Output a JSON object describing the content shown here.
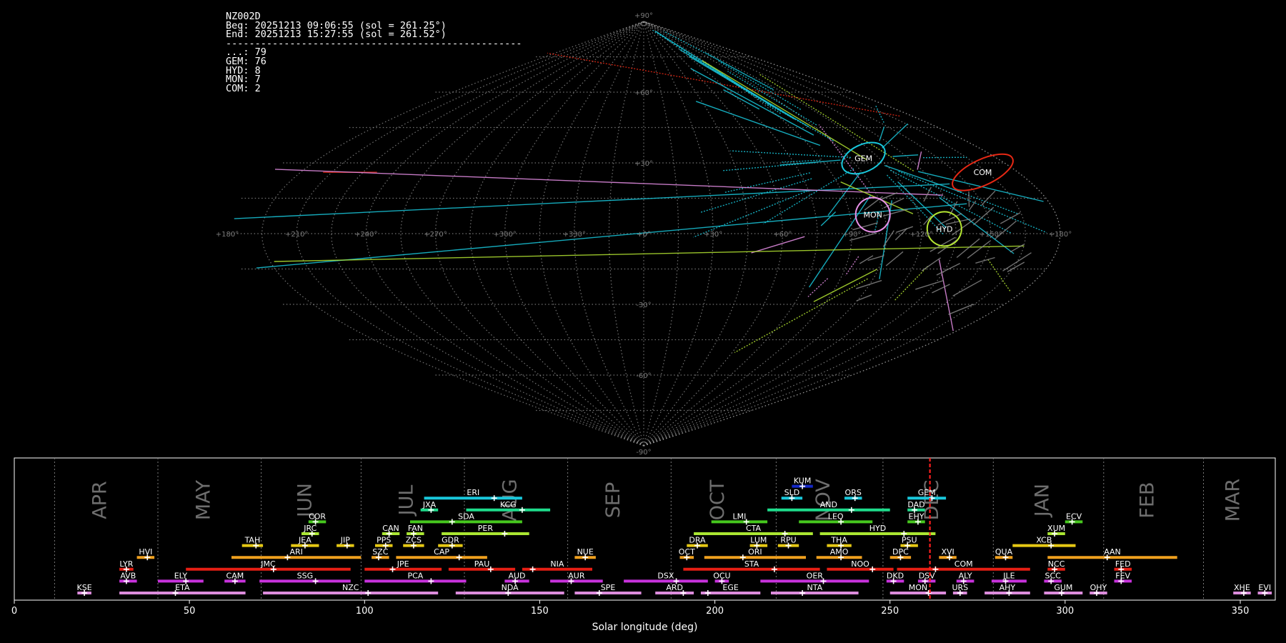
{
  "header": {
    "station": "NZ002D",
    "begin": "Beg: 20251213 09:06:55 (sol = 261.25°)",
    "end": "End: 20251213 15:27:55 (sol = 261.52°)",
    "separator": "---------------------------------------------------",
    "counts": [
      {
        "code": "...",
        "count": 79
      },
      {
        "code": "GEM",
        "count": 76
      },
      {
        "code": "HYD",
        "count": 8
      },
      {
        "code": "MON",
        "count": 7
      },
      {
        "code": "COM",
        "count": 2
      }
    ]
  },
  "colors": {
    "background": "#000000",
    "grid": "#9a9a9a",
    "GEM": "#19c8dc",
    "HYD": "#b4e632",
    "MON": "#e890e8",
    "COM": "#e62814",
    "sporadic": "#8c8c8c",
    "current_sol": "#ff1e1e"
  },
  "chart_data": [
    {
      "type": "sky-map",
      "projection": "sinusoidal",
      "lat_ticks": [
        "+90°",
        "+60°",
        "+30°",
        "+0°",
        "-30°",
        "-60°",
        "-90°"
      ],
      "lon_ticks": [
        "+180°",
        "+150°",
        "+120°",
        "+90°",
        "+60°",
        "+30°",
        "+0°",
        "+330°",
        "+300°",
        "+270°",
        "+240°",
        "+210°",
        "+180°"
      ],
      "radiants": [
        {
          "code": "COM",
          "ra": 163,
          "dec": 26,
          "color": "#e62814",
          "count": 2
        },
        {
          "code": "GEM",
          "ra": 112,
          "dec": 32,
          "color": "#19c8dc",
          "count": 76
        },
        {
          "code": "MON",
          "ra": 100,
          "dec": 8,
          "color": "#e890e8",
          "count": 7
        },
        {
          "code": "HYD",
          "ra": 130,
          "dec": 2,
          "color": "#b4e632",
          "count": 8
        }
      ]
    },
    {
      "type": "timeline",
      "xlabel": "Solar longitude (deg)",
      "xlim": [
        0,
        360
      ],
      "xticks": [
        0,
        50,
        100,
        150,
        200,
        250,
        300,
        350
      ],
      "current_sol": 261.4,
      "months": [
        {
          "label": "APR",
          "start": 11.5,
          "end": 41
        },
        {
          "label": "MAY",
          "start": 41,
          "end": 70.5
        },
        {
          "label": "JUN",
          "start": 70.5,
          "end": 99
        },
        {
          "label": "JUL",
          "start": 99,
          "end": 128.5
        },
        {
          "label": "AUG",
          "start": 128.5,
          "end": 158
        },
        {
          "label": "SEP",
          "start": 158,
          "end": 187.5
        },
        {
          "label": "OCT",
          "start": 187.5,
          "end": 217.5
        },
        {
          "label": "NOV",
          "start": 217.5,
          "end": 248
        },
        {
          "label": "DEC",
          "start": 248,
          "end": 279.5
        },
        {
          "label": "JAN",
          "start": 279.5,
          "end": 311
        },
        {
          "label": "FEB",
          "start": 311,
          "end": 339.5
        },
        {
          "label": "MAR",
          "start": 339.5,
          "end": 371.5
        }
      ],
      "showers": [
        {
          "code": "KUM",
          "row": 9,
          "start": 222,
          "end": 228,
          "peak": 225,
          "color": "#1428c8"
        },
        {
          "code": "ERI",
          "row": 8,
          "start": 117,
          "end": 145,
          "peak": 137,
          "color": "#19c8dc"
        },
        {
          "code": "SLD",
          "row": 8,
          "start": 219,
          "end": 225,
          "peak": 222,
          "color": "#19c8dc"
        },
        {
          "code": "ORS",
          "row": 8,
          "start": 237,
          "end": 242,
          "peak": 240,
          "color": "#19c8dc"
        },
        {
          "code": "GEM",
          "row": 8,
          "start": 255,
          "end": 266,
          "peak": 262,
          "color": "#19c8dc"
        },
        {
          "code": "JXA",
          "row": 7,
          "start": 116,
          "end": 121,
          "peak": 119,
          "color": "#1edc8c"
        },
        {
          "code": "KCG",
          "row": 7,
          "start": 129,
          "end": 153,
          "peak": 145,
          "color": "#1edc8c"
        },
        {
          "code": "AND",
          "row": 7,
          "start": 215,
          "end": 250,
          "peak": 239,
          "color": "#1edc8c"
        },
        {
          "code": "DAD",
          "row": 7,
          "start": 255,
          "end": 260,
          "peak": 257,
          "color": "#1edc8c"
        },
        {
          "code": "COR",
          "row": 6,
          "start": 84,
          "end": 89,
          "peak": 86,
          "color": "#46c81e"
        },
        {
          "code": "SDA",
          "row": 6,
          "start": 113,
          "end": 145,
          "peak": 125,
          "color": "#46c81e"
        },
        {
          "code": "LMI",
          "row": 6,
          "start": 199,
          "end": 215,
          "peak": 209,
          "color": "#46c81e"
        },
        {
          "code": "LEO",
          "row": 6,
          "start": 224,
          "end": 245,
          "peak": 236,
          "color": "#46c81e"
        },
        {
          "code": "EHY",
          "row": 6,
          "start": 255,
          "end": 260,
          "peak": 258,
          "color": "#46c81e"
        },
        {
          "code": "ECV",
          "row": 6,
          "start": 300,
          "end": 305,
          "peak": 302,
          "color": "#46c81e"
        },
        {
          "code": "JRC",
          "row": 5,
          "start": 82,
          "end": 87,
          "peak": 85,
          "color": "#aae632"
        },
        {
          "code": "CAN",
          "row": 5,
          "start": 105,
          "end": 110,
          "peak": 107,
          "color": "#aae632"
        },
        {
          "code": "FAN",
          "row": 5,
          "start": 112,
          "end": 117,
          "peak": 114,
          "color": "#aae632"
        },
        {
          "code": "PER",
          "row": 5,
          "start": 122,
          "end": 147,
          "peak": 140,
          "color": "#aae632"
        },
        {
          "code": "CTA",
          "row": 5,
          "start": 194,
          "end": 228,
          "peak": 220,
          "color": "#aae632"
        },
        {
          "code": "HYD",
          "row": 5,
          "start": 230,
          "end": 263,
          "peak": 254,
          "color": "#aae632"
        },
        {
          "code": "XUM",
          "row": 5,
          "start": 295,
          "end": 300,
          "peak": 297,
          "color": "#aae632"
        },
        {
          "code": "TAH",
          "row": 4,
          "start": 65,
          "end": 71,
          "peak": 69,
          "color": "#e6c814"
        },
        {
          "code": "JEA",
          "row": 4,
          "start": 79,
          "end": 87,
          "peak": 83,
          "color": "#e6c814"
        },
        {
          "code": "JIP",
          "row": 4,
          "start": 92,
          "end": 97,
          "peak": 95,
          "color": "#e6c814"
        },
        {
          "code": "PPS",
          "row": 4,
          "start": 103,
          "end": 108,
          "peak": 106,
          "color": "#e6c814"
        },
        {
          "code": "ZCS",
          "row": 4,
          "start": 111,
          "end": 117,
          "peak": 114,
          "color": "#e6c814"
        },
        {
          "code": "GDR",
          "row": 4,
          "start": 121,
          "end": 128,
          "peak": 125,
          "color": "#e6c814"
        },
        {
          "code": "DRA",
          "row": 4,
          "start": 192,
          "end": 198,
          "peak": 195,
          "color": "#e6c814"
        },
        {
          "code": "LUM",
          "row": 4,
          "start": 210,
          "end": 215,
          "peak": 212,
          "color": "#e6c814"
        },
        {
          "code": "RPU",
          "row": 4,
          "start": 218,
          "end": 224,
          "peak": 221,
          "color": "#e6c814"
        },
        {
          "code": "THA",
          "row": 4,
          "start": 232,
          "end": 239,
          "peak": 236,
          "color": "#e6c814"
        },
        {
          "code": "PSU",
          "row": 4,
          "start": 253,
          "end": 258,
          "peak": 255,
          "color": "#e6c814"
        },
        {
          "code": "XCB",
          "row": 4,
          "start": 285,
          "end": 303,
          "peak": 296,
          "color": "#e6c814"
        },
        {
          "code": "HVI",
          "row": 3,
          "start": 35,
          "end": 40,
          "peak": 38,
          "color": "#f0a01e"
        },
        {
          "code": "ARI",
          "row": 3,
          "start": 62,
          "end": 99,
          "peak": 78,
          "color": "#f0a01e"
        },
        {
          "code": "SZC",
          "row": 3,
          "start": 102,
          "end": 107,
          "peak": 104,
          "color": "#f0a01e"
        },
        {
          "code": "CAP",
          "row": 3,
          "start": 109,
          "end": 135,
          "peak": 127,
          "color": "#f0a01e"
        },
        {
          "code": "NUE",
          "row": 3,
          "start": 160,
          "end": 166,
          "peak": 163,
          "color": "#f0a01e"
        },
        {
          "code": "OCT",
          "row": 3,
          "start": 190,
          "end": 194,
          "peak": 192,
          "color": "#f0a01e"
        },
        {
          "code": "ORI",
          "row": 3,
          "start": 197,
          "end": 226,
          "peak": 208,
          "color": "#f0a01e"
        },
        {
          "code": "AMO",
          "row": 3,
          "start": 229,
          "end": 242,
          "peak": 236,
          "color": "#f0a01e"
        },
        {
          "code": "DPC",
          "row": 3,
          "start": 250,
          "end": 256,
          "peak": 253,
          "color": "#f0a01e"
        },
        {
          "code": "XVI",
          "row": 3,
          "start": 264,
          "end": 269,
          "peak": 267,
          "color": "#f0a01e"
        },
        {
          "code": "QUA",
          "row": 3,
          "start": 280,
          "end": 285,
          "peak": 283,
          "color": "#f0a01e"
        },
        {
          "code": "AAN",
          "row": 3,
          "start": 295,
          "end": 332,
          "peak": 312,
          "color": "#f0a01e"
        },
        {
          "code": "LYR",
          "row": 2,
          "start": 30,
          "end": 34,
          "peak": 32,
          "color": "#e61e14"
        },
        {
          "code": "JMC",
          "row": 2,
          "start": 49,
          "end": 96,
          "peak": 74,
          "color": "#e61e14"
        },
        {
          "code": "JPE",
          "row": 2,
          "start": 100,
          "end": 122,
          "peak": 108,
          "color": "#e61e14"
        },
        {
          "code": "PAU",
          "row": 2,
          "start": 124,
          "end": 143,
          "peak": 136,
          "color": "#e61e14"
        },
        {
          "code": "NIA",
          "row": 2,
          "start": 145,
          "end": 165,
          "peak": 148,
          "color": "#e61e14"
        },
        {
          "code": "STA",
          "row": 2,
          "start": 191,
          "end": 230,
          "peak": 217,
          "color": "#e61e14"
        },
        {
          "code": "NOO",
          "row": 2,
          "start": 232,
          "end": 251,
          "peak": 245,
          "color": "#e61e14"
        },
        {
          "code": "COM",
          "row": 2,
          "start": 252,
          "end": 290,
          "peak": 263,
          "color": "#e61e14"
        },
        {
          "code": "NCC",
          "row": 2,
          "start": 295,
          "end": 300,
          "peak": 297,
          "color": "#e61e14"
        },
        {
          "code": "FED",
          "row": 2,
          "start": 314,
          "end": 319,
          "peak": 316,
          "color": "#e61e14"
        },
        {
          "code": "AVB",
          "row": 1,
          "start": 30,
          "end": 35,
          "peak": 32,
          "color": "#c832dc"
        },
        {
          "code": "ELY",
          "row": 1,
          "start": 41,
          "end": 54,
          "peak": 49,
          "color": "#c832dc"
        },
        {
          "code": "CAM",
          "row": 1,
          "start": 60,
          "end": 66,
          "peak": 63,
          "color": "#c832dc"
        },
        {
          "code": "SSG",
          "row": 1,
          "start": 70,
          "end": 96,
          "peak": 86,
          "color": "#c832dc"
        },
        {
          "code": "PCA",
          "row": 1,
          "start": 100,
          "end": 129,
          "peak": 119,
          "color": "#c832dc"
        },
        {
          "code": "AUD",
          "row": 1,
          "start": 140,
          "end": 147,
          "peak": 143,
          "color": "#c832dc"
        },
        {
          "code": "AUR",
          "row": 1,
          "start": 153,
          "end": 168,
          "peak": 159,
          "color": "#c832dc"
        },
        {
          "code": "DSX",
          "row": 1,
          "start": 174,
          "end": 198,
          "peak": 189,
          "color": "#c832dc"
        },
        {
          "code": "OCU",
          "row": 1,
          "start": 200,
          "end": 204,
          "peak": 202,
          "color": "#c832dc"
        },
        {
          "code": "OER",
          "row": 1,
          "start": 213,
          "end": 244,
          "peak": 231,
          "color": "#c832dc"
        },
        {
          "code": "DKD",
          "row": 1,
          "start": 249,
          "end": 254,
          "peak": 251,
          "color": "#c832dc"
        },
        {
          "code": "DSV",
          "row": 1,
          "start": 258,
          "end": 263,
          "peak": 260,
          "color": "#c832dc"
        },
        {
          "code": "ALY",
          "row": 1,
          "start": 269,
          "end": 274,
          "peak": 271,
          "color": "#c832dc"
        },
        {
          "code": "JLE",
          "row": 1,
          "start": 279,
          "end": 289,
          "peak": 283,
          "color": "#c832dc"
        },
        {
          "code": "SCC",
          "row": 1,
          "start": 294,
          "end": 299,
          "peak": 296,
          "color": "#c832dc"
        },
        {
          "code": "FEV",
          "row": 1,
          "start": 314,
          "end": 319,
          "peak": 316,
          "color": "#c832dc"
        },
        {
          "code": "KSE",
          "row": 0,
          "start": 18,
          "end": 22,
          "peak": 20,
          "color": "#dc8cdc"
        },
        {
          "code": "ETA",
          "row": 0,
          "start": 30,
          "end": 66,
          "peak": 46,
          "color": "#dc8cdc"
        },
        {
          "code": "NZC",
          "row": 0,
          "start": 71,
          "end": 121,
          "peak": 101,
          "color": "#dc8cdc"
        },
        {
          "code": "NDA",
          "row": 0,
          "start": 126,
          "end": 157,
          "peak": 141,
          "color": "#dc8cdc"
        },
        {
          "code": "SPE",
          "row": 0,
          "start": 160,
          "end": 179,
          "peak": 167,
          "color": "#dc8cdc"
        },
        {
          "code": "ARD",
          "row": 0,
          "start": 183,
          "end": 194,
          "peak": 191,
          "color": "#dc8cdc"
        },
        {
          "code": "EGE",
          "row": 0,
          "start": 196,
          "end": 213,
          "peak": 198,
          "color": "#dc8cdc"
        },
        {
          "code": "NTA",
          "row": 0,
          "start": 216,
          "end": 241,
          "peak": 225,
          "color": "#dc8cdc"
        },
        {
          "code": "MON",
          "row": 0,
          "start": 250,
          "end": 266,
          "peak": 261,
          "color": "#dc8cdc"
        },
        {
          "code": "URS",
          "row": 0,
          "start": 268,
          "end": 272,
          "peak": 270,
          "color": "#dc8cdc"
        },
        {
          "code": "AHY",
          "row": 0,
          "start": 277,
          "end": 290,
          "peak": 284,
          "color": "#dc8cdc"
        },
        {
          "code": "GUM",
          "row": 0,
          "start": 294,
          "end": 305,
          "peak": 299,
          "color": "#dc8cdc"
        },
        {
          "code": "OHY",
          "row": 0,
          "start": 307,
          "end": 312,
          "peak": 309,
          "color": "#dc8cdc"
        },
        {
          "code": "XHE",
          "row": 0,
          "start": 348,
          "end": 353,
          "peak": 351,
          "color": "#dc8cdc"
        },
        {
          "code": "EVI",
          "row": 0,
          "start": 355,
          "end": 359,
          "peak": 357,
          "color": "#dc8cdc"
        }
      ]
    }
  ]
}
